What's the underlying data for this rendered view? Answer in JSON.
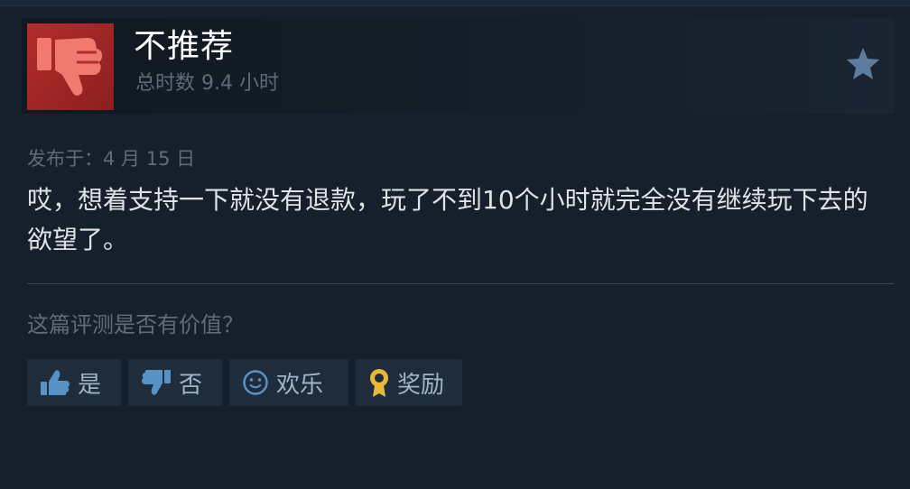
{
  "review": {
    "verdict": "不推荐",
    "hours": "总时数 9.4 小时",
    "posted": "发布于：4 月 15 日",
    "text": "哎，想着支持一下就没有退款，玩了不到10个小时就完全没有继续玩下去的欲望了。"
  },
  "helpful": {
    "question": "这篇评测是否有价值？",
    "yes_label": "是",
    "no_label": "否",
    "funny_label": "欢乐",
    "award_label": "奖励"
  },
  "icons": {
    "verdict": "thumbs-down-icon",
    "star": "star-icon",
    "yes": "thumbs-up-icon",
    "no": "thumbs-down-icon",
    "funny": "smiley-icon",
    "award": "award-ribbon-icon"
  },
  "colors": {
    "background": "#16202d",
    "verdict_red": "#b52c2c",
    "button_bg": "#1e2c3c",
    "muted_text": "#5f6b79",
    "award_gold": "#e8b83c"
  }
}
